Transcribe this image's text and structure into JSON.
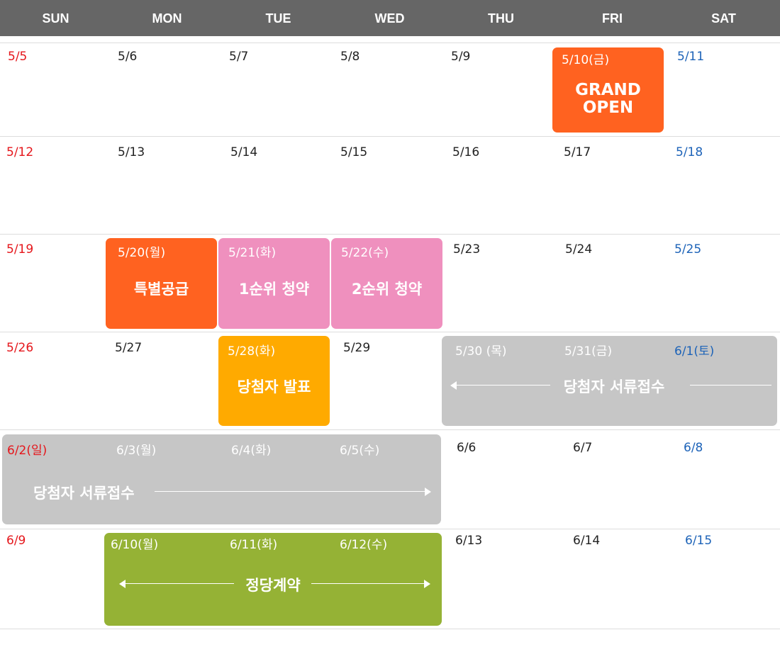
{
  "weekdays": [
    "SUN",
    "MON",
    "TUE",
    "WED",
    "THU",
    "FRI",
    "SAT"
  ],
  "colors": {
    "header": "#666666",
    "sunday": "#e5161b",
    "saturday": "#1d63b8",
    "orange": "#ff6220",
    "pink": "#ef90be",
    "amber": "#ffaa00",
    "gray": "#c6c6c6",
    "green": "#95b235"
  },
  "weeks": [
    [
      "5/5",
      "5/6",
      "5/7",
      "5/8",
      "5/9",
      "5/10(금)",
      "5/11"
    ],
    [
      "5/12",
      "5/13",
      "5/14",
      "5/15",
      "5/16",
      "5/17",
      "5/18"
    ],
    [
      "5/19",
      "5/20(월)",
      "5/21(화)",
      "5/22(수)",
      "5/23",
      "5/24",
      "5/25"
    ],
    [
      "5/26",
      "5/27",
      "5/28(화)",
      "5/29",
      "5/30 (목)",
      "5/31(금)",
      "6/1(토)"
    ],
    [
      "6/2(일)",
      "6/3(월)",
      "6/4(화)",
      "6/5(수)",
      "6/6",
      "6/7",
      "6/8"
    ],
    [
      "6/9",
      "6/10(월)",
      "6/11(화)",
      "6/12(수)",
      "6/13",
      "6/14",
      "6/15"
    ]
  ],
  "events": {
    "grand_open": "GRAND OPEN",
    "special_supply": "특별공급",
    "first_priority": "1순위 청약",
    "second_priority": "2순위 청약",
    "winner_announcement": "당첨자 발표",
    "document_submission": "당첨자 서류접수",
    "contract": "정당계약"
  }
}
